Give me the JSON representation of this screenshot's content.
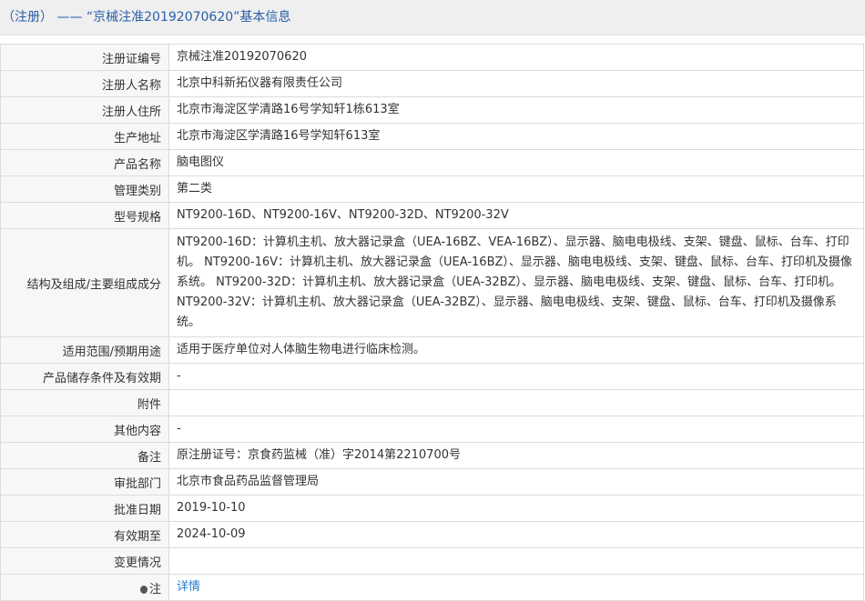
{
  "header": {
    "title": "（注册） —— “京械注准20192070620”基本信息"
  },
  "rows": [
    {
      "label": "注册证编号",
      "value": "京械注准20192070620"
    },
    {
      "label": "注册人名称",
      "value": "北京中科新拓仪器有限责任公司"
    },
    {
      "label": "注册人住所",
      "value": "北京市海淀区学清路16号学知轩1栋613室"
    },
    {
      "label": "生产地址",
      "value": "北京市海淀区学清路16号学知轩613室"
    },
    {
      "label": "产品名称",
      "value": "脑电图仪"
    },
    {
      "label": "管理类别",
      "value": "第二类"
    },
    {
      "label": "型号规格",
      "value": "NT9200-16D、NT9200-16V、NT9200-32D、NT9200-32V"
    },
    {
      "label": "结构及组成/主要组成成分",
      "value": "NT9200-16D：计算机主机、放大器记录盒（UEA-16BZ、VEA-16BZ）、显示器、脑电电极线、支架、键盘、鼠标、台车、打印机。 NT9200-16V：计算机主机、放大器记录盒（UEA-16BZ）、显示器、脑电电极线、支架、键盘、鼠标、台车、打印机及摄像系统。 NT9200-32D：计算机主机、放大器记录盒（UEA-32BZ）、显示器、脑电电极线、支架、键盘、鼠标、台车、打印机。 NT9200-32V：计算机主机、放大器记录盒（UEA-32BZ）、显示器、脑电电极线、支架、键盘、鼠标、台车、打印机及摄像系统。"
    },
    {
      "label": "适用范围/预期用途",
      "value": "适用于医疗单位对人体脑生物电进行临床检测。"
    },
    {
      "label": "产品储存条件及有效期",
      "value": "-"
    },
    {
      "label": "附件",
      "value": ""
    },
    {
      "label": "其他内容",
      "value": "-"
    },
    {
      "label": "备注",
      "value": "原注册证号：京食药监械（准）字2014第2210700号"
    },
    {
      "label": "审批部门",
      "value": "北京市食品药品监督管理局"
    },
    {
      "label": "批准日期",
      "value": "2019-10-10"
    },
    {
      "label": "有效期至",
      "value": "2024-10-09"
    },
    {
      "label": "变更情况",
      "value": ""
    }
  ],
  "note": {
    "label": "注",
    "link": "详情",
    "icon": "bulb-icon"
  }
}
